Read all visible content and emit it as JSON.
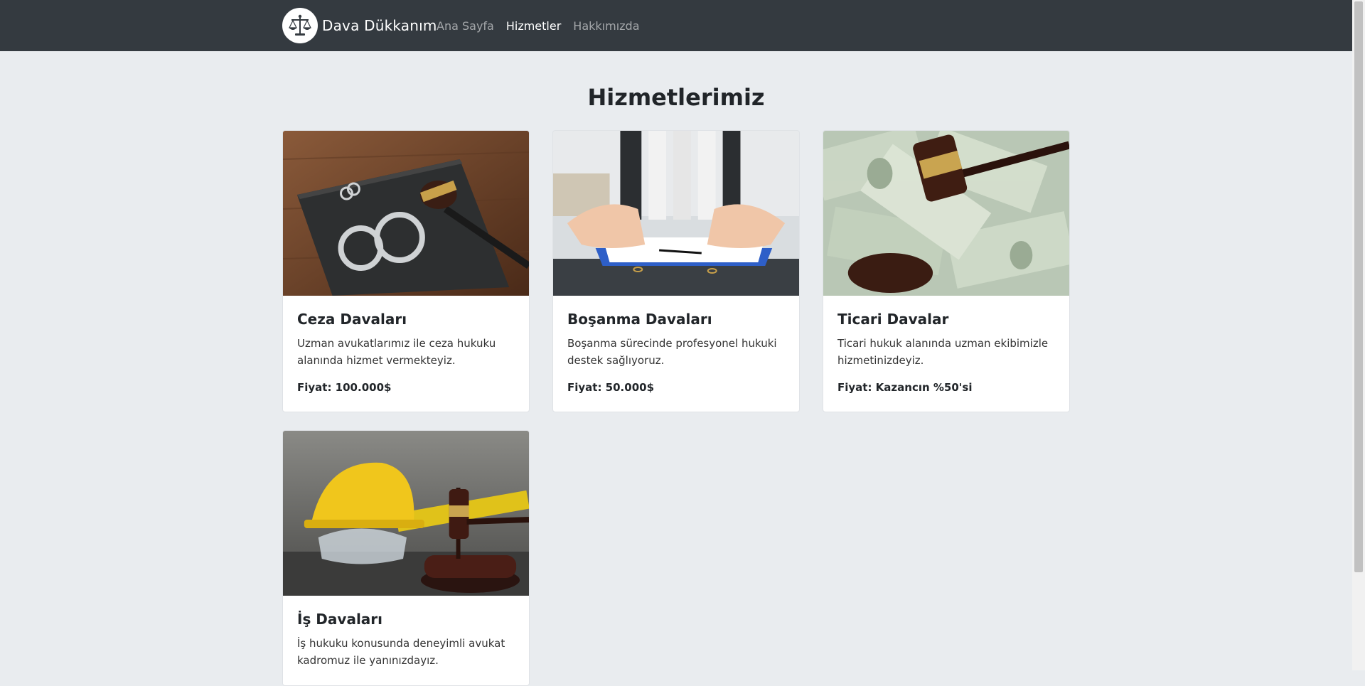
{
  "brand": {
    "name": "Dava Dükkanım",
    "logo_icon": "scales-of-justice-icon"
  },
  "nav": [
    {
      "label": "Ana Sayfa",
      "active": false
    },
    {
      "label": "Hizmetler",
      "active": true
    },
    {
      "label": "Hakkımızda",
      "active": false
    }
  ],
  "page": {
    "title": "Hizmetlerimiz"
  },
  "services": [
    {
      "title": "Ceza Davaları",
      "description": "Uzman avukatlarımız ile ceza hukuku alanında hizmet vermekteyiz.",
      "price": "Fiyat: 100.000$",
      "image": "handcuffs-and-gavel-image"
    },
    {
      "title": "Boşanma Davaları",
      "description": "Boşanma sürecinde profesyonel hukuki destek sağlıyoruz.",
      "price": "Fiyat: 50.000$",
      "image": "clasped-hands-and-documents-image"
    },
    {
      "title": "Ticari Davalar",
      "description": "Ticari hukuk alanında uzman ekibimizle hizmetinizdeyiz.",
      "price": "Fiyat: Kazancın %50'si",
      "image": "gavel-on-dollar-bills-image"
    },
    {
      "title": "İş Davaları",
      "description": "İş hukuku konusunda deneyimli avukat kadromuz ile yanınızdayız.",
      "price": "",
      "image": "hard-hat-and-gavel-image"
    }
  ]
}
